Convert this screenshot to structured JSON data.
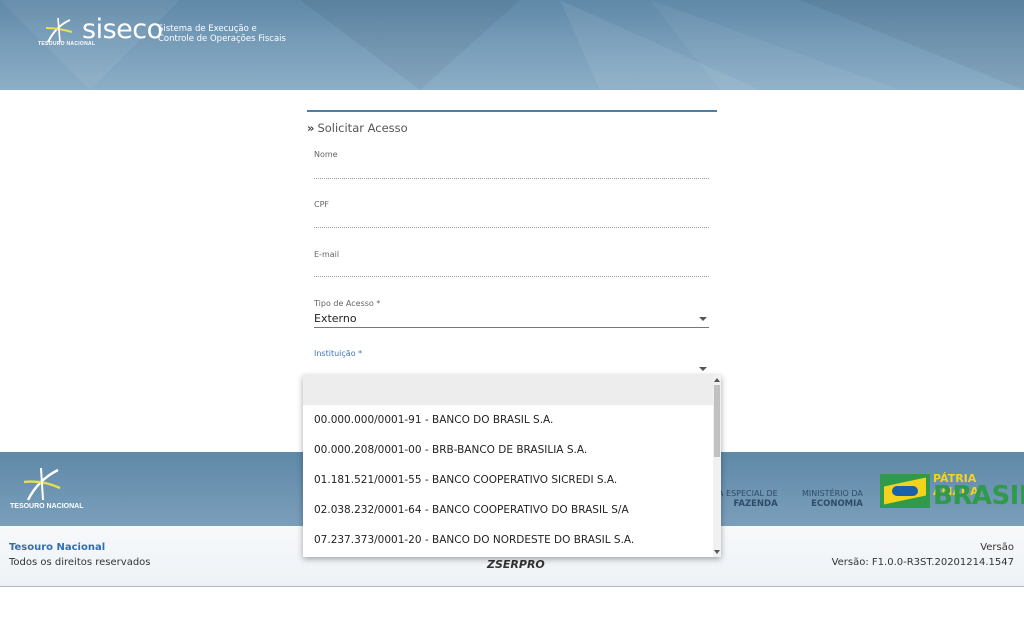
{
  "header": {
    "brand": "siseco",
    "subtitle_line1": "Sistema de Execução e",
    "subtitle_line2": "Controle de Operações Fiscais",
    "org_small": "TESOURO NACIONAL"
  },
  "form": {
    "title": "Solicitar Acesso",
    "fields": {
      "nome": {
        "label": "Nome",
        "value": ""
      },
      "cpf": {
        "label": "CPF",
        "value": ""
      },
      "email": {
        "label": "E-mail",
        "value": ""
      },
      "tipo_acesso": {
        "label": "Tipo de Acesso *",
        "value": "Externo"
      },
      "instituicao": {
        "label": "Instituição *",
        "value": ""
      }
    }
  },
  "dropdown": {
    "search_value": "",
    "options": [
      "00.000.000/0001-91 - BANCO DO BRASIL S.A.",
      "00.000.208/0001-00 - BRB-BANCO DE BRASILIA S.A.",
      "01.181.521/0001-55 - BANCO COOPERATIVO SICREDI S.A.",
      "02.038.232/0001-64 - BANCO COOPERATIVO DO BRASIL S/A",
      "07.237.373/0001-20 - BANCO DO NORDESTE DO BRASIL S.A."
    ]
  },
  "footer": {
    "tesouro_label": "TESOURO NACIONAL",
    "fazenda_line1": "A ESPECIAL DE",
    "fazenda_line2": "FAZENDA",
    "economia_line1": "MINISTÉRIO DA",
    "economia_line2": "ECONOMIA",
    "patria_line1": "PÁTRIA AMADA",
    "patria_line2": "BRASIL",
    "org_name": "Tesouro Nacional",
    "rights": "Todos os direitos reservados",
    "serpro": "SERPRO",
    "version_title": "Versão",
    "version_value": "Versão: F1.0.0-R3ST.20201214.1547"
  },
  "colors": {
    "header_blue": "#6f95b3",
    "accent_blue": "#4b7fa8",
    "focus_label": "#3b74c2",
    "brasil_green": "#2e9a4a",
    "brasil_yellow": "#f3d31c"
  }
}
